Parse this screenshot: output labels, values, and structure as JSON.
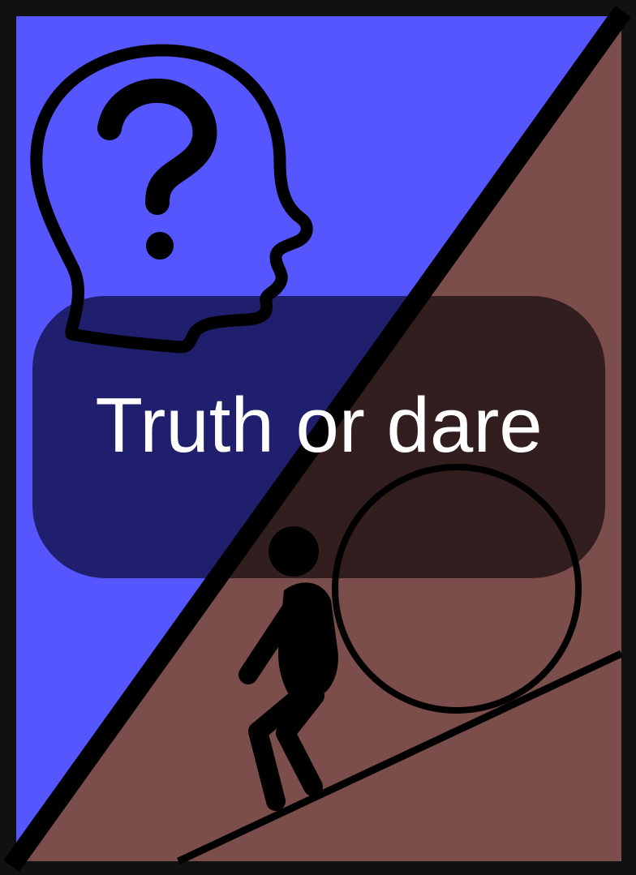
{
  "card": {
    "title": "Truth or dare",
    "truth_icon": "head-question-icon",
    "dare_icon": "boulder-push-icon"
  },
  "colors": {
    "frame": "#111111",
    "truth_bg": "#5656ff",
    "dare_bg": "#7b4d4b",
    "pill_truth": "#1f1f6e",
    "pill_dare": "#321e1f",
    "text": "#ffffff",
    "ink": "#000000"
  }
}
